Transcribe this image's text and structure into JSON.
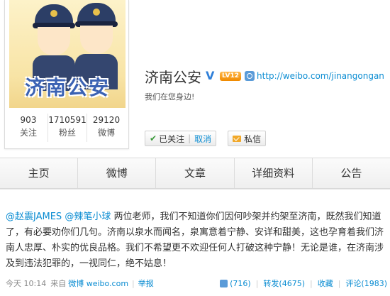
{
  "profile": {
    "avatar_text": "济南公安",
    "name": "济南公安",
    "verified_mark": "V",
    "level": "LV12",
    "url": "http://weibo.com/jinangongan",
    "motto": "我们在您身边!"
  },
  "stats": [
    {
      "value": "903",
      "label": "关注"
    },
    {
      "value": "1710591",
      "label": "粉丝"
    },
    {
      "value": "29120",
      "label": "微博"
    }
  ],
  "buttons": {
    "followed": "已关注",
    "cancel": "取消",
    "message": "私信"
  },
  "tabs": [
    "主页",
    "微博",
    "文章",
    "详细资料",
    "公告"
  ],
  "post": {
    "mention1": "@赵震JAMES",
    "mention2": "@辣笔小球",
    "text": "两位老师，我们不知道你们因何吵架并约架至济南，既然我们知道了，有必要劝你们几句。济南以泉水而闻名，泉寓意着宁静、安详和甜美，这也孕育着我们济南人忠厚、朴实的优良品格。我们不希望更不欢迎任何人打破这种宁静！无论是谁，在济南涉及到违法犯罪的，一视同仁，绝不姑息！",
    "time": "今天 10:14",
    "from_label": "来自",
    "source": "微博 weibo.com",
    "report": "举报",
    "likes": "(716)",
    "repost": "转发(4675)",
    "favorite": "收藏",
    "comment": "评论(1983)"
  },
  "colors": {
    "accent": "#0a8cd2",
    "brand_blue": "#3b62b3",
    "level_orange": "#f08a00"
  },
  "icons": [
    "verified-icon",
    "level-badge",
    "link-icon",
    "check-icon",
    "mail-icon",
    "like-icon"
  ]
}
